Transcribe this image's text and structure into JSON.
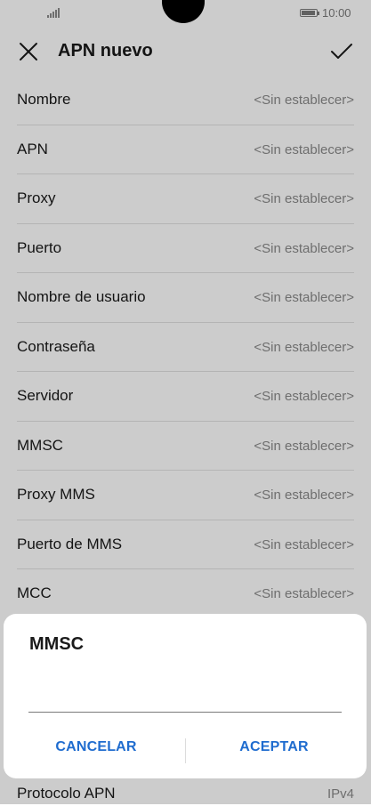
{
  "status_bar": {
    "time": "10:00"
  },
  "header": {
    "title": "APN nuevo",
    "close_icon": "close-icon",
    "confirm_icon": "check-icon"
  },
  "fields": [
    {
      "label": "Nombre",
      "value": "<Sin establecer>"
    },
    {
      "label": "APN",
      "value": "<Sin establecer>"
    },
    {
      "label": "Proxy",
      "value": "<Sin establecer>"
    },
    {
      "label": "Puerto",
      "value": "<Sin establecer>"
    },
    {
      "label": "Nombre de usuario",
      "value": "<Sin establecer>"
    },
    {
      "label": "Contraseña",
      "value": "<Sin establecer>"
    },
    {
      "label": "Servidor",
      "value": "<Sin establecer>"
    },
    {
      "label": "MMSC",
      "value": "<Sin establecer>"
    },
    {
      "label": "Proxy MMS",
      "value": "<Sin establecer>"
    },
    {
      "label": "Puerto de MMS",
      "value": "<Sin establecer>"
    },
    {
      "label": "MCC",
      "value": "<Sin establecer>"
    }
  ],
  "bottom_field": {
    "label": "Protocolo APN",
    "value": "IPv4"
  },
  "dialog": {
    "title": "MMSC",
    "input_value": "",
    "cancel_label": "CANCELAR",
    "ok_label": "ACEPTAR"
  },
  "colors": {
    "accent": "#1f6ccf",
    "overlay": "rgba(0,0,0,0.20)"
  }
}
